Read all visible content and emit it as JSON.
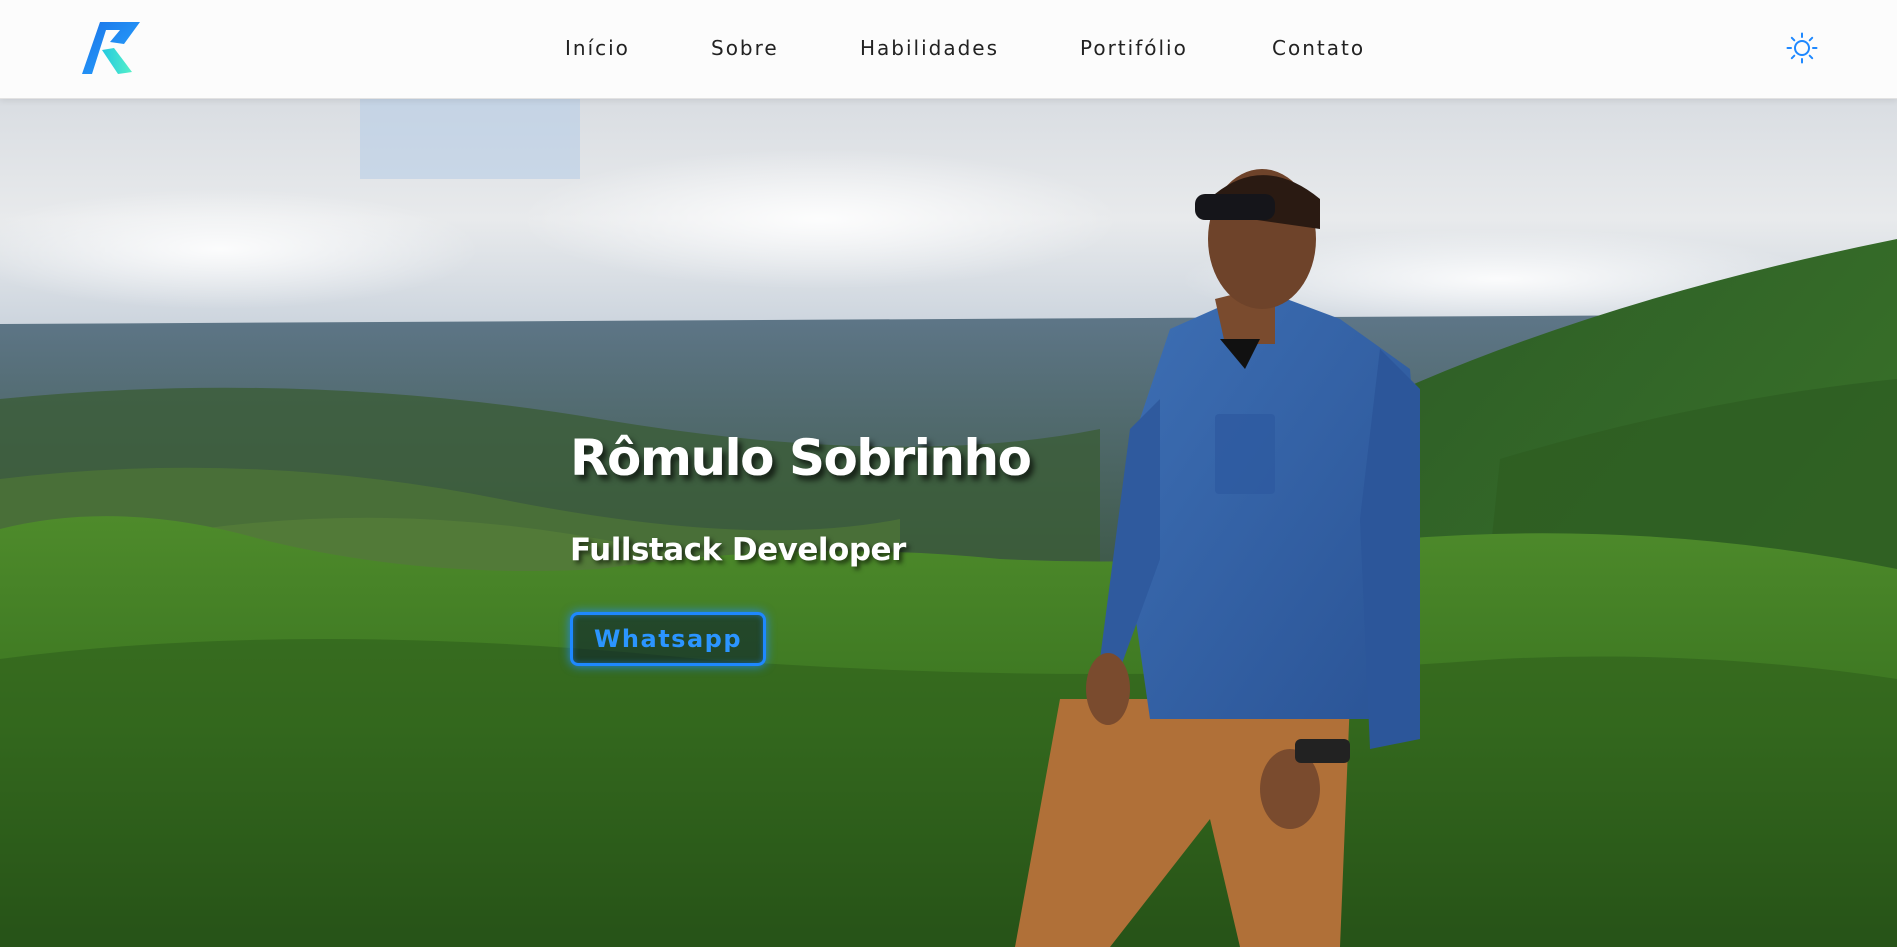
{
  "header": {
    "logo_icon": "r-logo-icon",
    "nav": [
      {
        "label": "Início"
      },
      {
        "label": "Sobre"
      },
      {
        "label": "Habilidades"
      },
      {
        "label": "Portifólio"
      },
      {
        "label": "Contato"
      }
    ],
    "theme_toggle_icon": "sun-icon"
  },
  "hero": {
    "title": "Rômulo Sobrinho",
    "subtitle": "Fullstack Developer",
    "cta_label": "Whatsapp"
  },
  "colors": {
    "accent": "#1e88ff",
    "logo_blue": "#1a73e8",
    "logo_teal": "#3ee0c8"
  }
}
